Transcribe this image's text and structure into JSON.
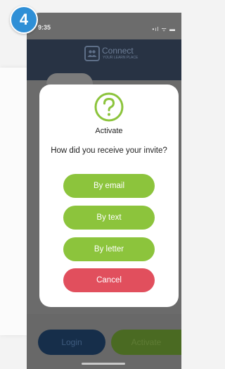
{
  "badge": {
    "step": "4"
  },
  "status_bar": {
    "time": "9:35",
    "icons": "•ıl ᯤ ▬"
  },
  "app_header": {
    "logo_title": "Connect",
    "logo_subtitle": "YOUR LEARN PLACE"
  },
  "background_buttons": {
    "login": "Login",
    "activate": "Activate"
  },
  "modal": {
    "title": "Activate",
    "question": "How did you receive your invite?",
    "options": [
      {
        "label": "By email"
      },
      {
        "label": "By text"
      },
      {
        "label": "By letter"
      }
    ],
    "cancel": "Cancel"
  },
  "colors": {
    "accent_green": "#8cc43c",
    "cancel_red": "#e14f5d",
    "badge_blue": "#2f8fd6",
    "header_navy": "#283344"
  },
  "icons": {
    "modal": "question-circle-icon",
    "logo": "people-chat-icon"
  }
}
